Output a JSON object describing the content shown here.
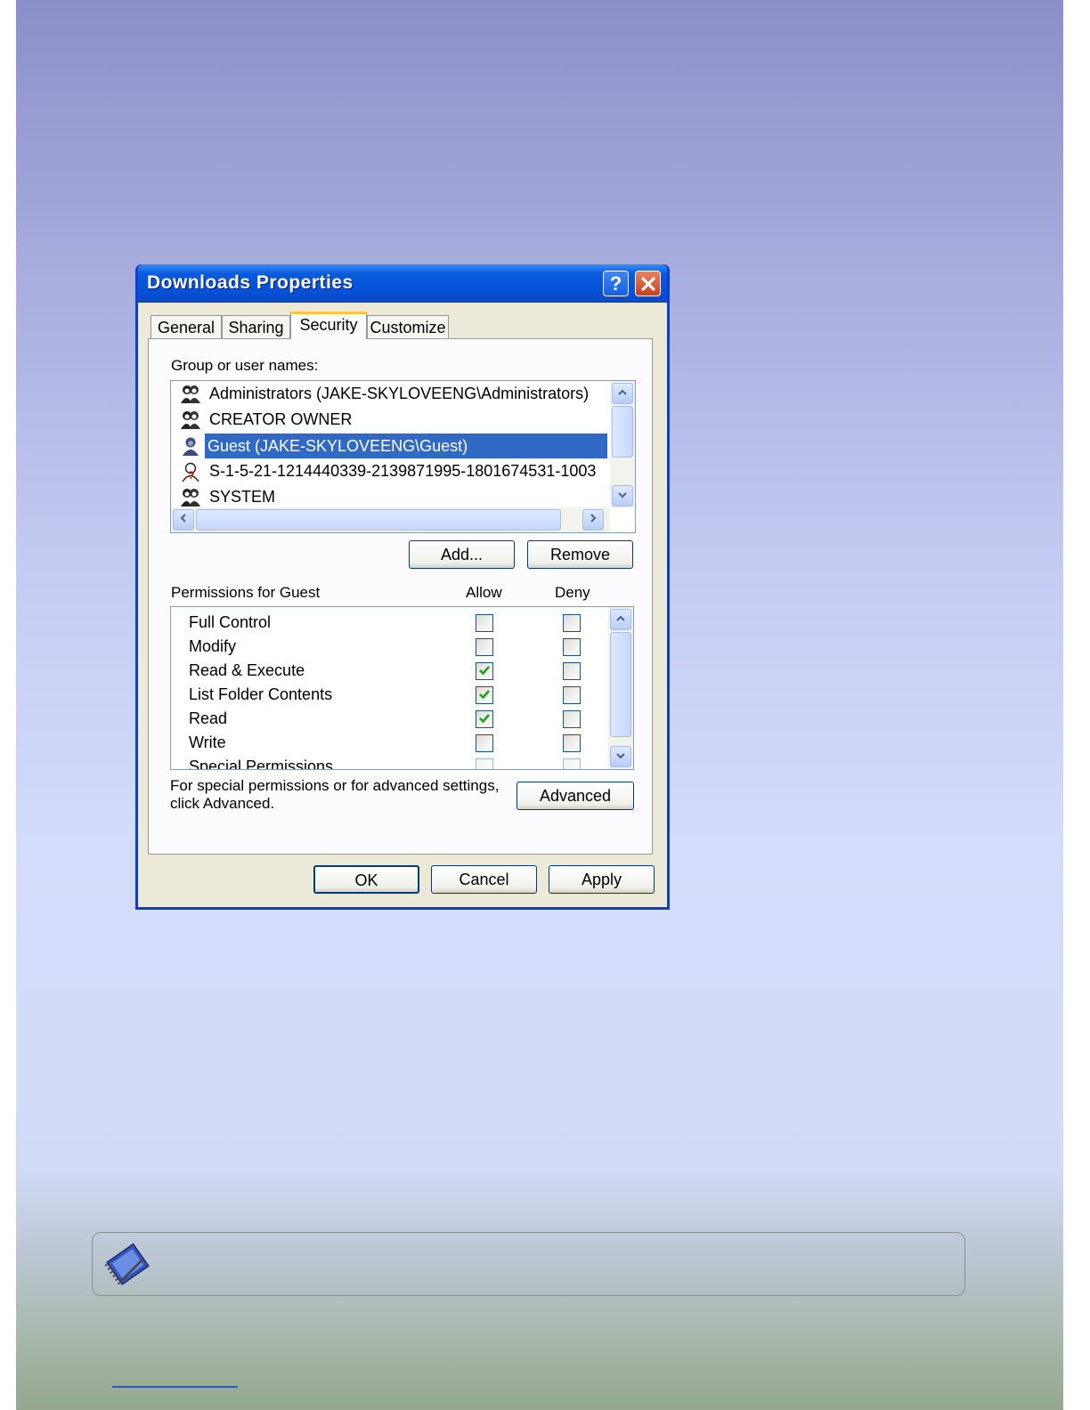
{
  "dialog": {
    "title": "Downloads Properties",
    "help_label": "?",
    "close_label": "✕",
    "tabs": [
      {
        "label": "General"
      },
      {
        "label": "Sharing"
      },
      {
        "label": "Security"
      },
      {
        "label": "Customize"
      }
    ],
    "active_tab": "Security",
    "group_label": "Group or user names:",
    "users": [
      {
        "name": "Administrators (JAKE-SKYLOVEENG\\Administrators)",
        "icon": "group-icon"
      },
      {
        "name": "CREATOR OWNER",
        "icon": "group-icon"
      },
      {
        "name": "Guest (JAKE-SKYLOVEENG\\Guest)",
        "icon": "user-icon",
        "selected": true
      },
      {
        "name": "S-1-5-21-1214440339-2139871995-1801674531-1003",
        "icon": "unknown-user-icon"
      },
      {
        "name": "SYSTEM",
        "icon": "group-icon"
      }
    ],
    "add_label": "Add...",
    "remove_label": "Remove",
    "permissions_label": "Permissions for Guest",
    "allow_label": "Allow",
    "deny_label": "Deny",
    "permissions": [
      {
        "name": "Full Control",
        "allow": false,
        "deny": false
      },
      {
        "name": "Modify",
        "allow": false,
        "deny": false
      },
      {
        "name": "Read & Execute",
        "allow": true,
        "deny": false
      },
      {
        "name": "List Folder Contents",
        "allow": true,
        "deny": false
      },
      {
        "name": "Read",
        "allow": true,
        "deny": false
      },
      {
        "name": "Write",
        "allow": false,
        "deny": false
      },
      {
        "name": "Special Permissions",
        "allow": false,
        "deny": false
      }
    ],
    "advanced_note": "For special permissions or for advanced settings, click Advanced.",
    "advanced_label": "Advanced",
    "ok_label": "OK",
    "cancel_label": "Cancel",
    "apply_label": "Apply"
  },
  "colors": {
    "selection": "#316ac5",
    "titlebar": "#0550d8",
    "check": "#21a121"
  }
}
